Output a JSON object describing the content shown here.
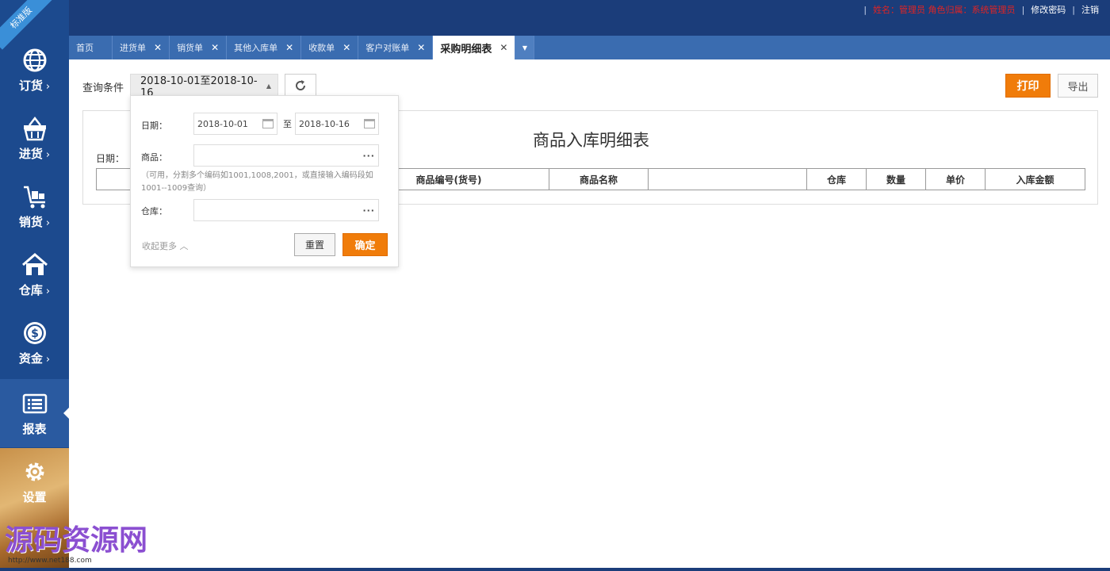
{
  "badge": "标准版",
  "topbar": {
    "user_info": "姓名：管理员  角色归属：系统管理员",
    "change_password": "修改密码",
    "logout": "注销"
  },
  "sidebar": {
    "items": [
      {
        "label": "订货",
        "icon": "globe-icon"
      },
      {
        "label": "进货",
        "icon": "basket-icon"
      },
      {
        "label": "销货",
        "icon": "cart-icon"
      },
      {
        "label": "仓库",
        "icon": "house-icon"
      },
      {
        "label": "资金",
        "icon": "dollar-icon"
      },
      {
        "label": "报表",
        "icon": "list-icon"
      },
      {
        "label": "设置",
        "icon": "gear-icon"
      }
    ],
    "chevron": "›"
  },
  "tabs": [
    {
      "label": "首页",
      "closable": false
    },
    {
      "label": "进货单",
      "closable": true
    },
    {
      "label": "销货单",
      "closable": true
    },
    {
      "label": "其他入库单",
      "closable": true
    },
    {
      "label": "收款单",
      "closable": true
    },
    {
      "label": "客户对账单",
      "closable": true
    },
    {
      "label": "采购明细表",
      "closable": true,
      "active": true
    }
  ],
  "toolbar": {
    "query_label": "查询条件",
    "date_range": "2018-10-01至2018-10-16",
    "print": "打印",
    "export": "导出"
  },
  "report": {
    "title": "商品入库明细表",
    "date_label": "日期：",
    "columns": [
      "",
      "商品编号(货号)",
      "商品名称",
      "",
      "仓库",
      "数量",
      "单价",
      "入库金额"
    ]
  },
  "popup": {
    "date_label": "日期：",
    "date_from": "2018-10-01",
    "date_to_sep": "至",
    "date_to": "2018-10-16",
    "product_label": "商品：",
    "product_hint": "（可用，分割多个编码如1001,1008,2001，或直接输入编码段如1001--1009查询）",
    "warehouse_label": "仓库：",
    "collapse": "收起更多",
    "reset": "重置",
    "confirm": "确定"
  },
  "watermark": {
    "text": "源码资源网",
    "url": "http://www.net188.com"
  },
  "colors": {
    "topbar": "#1b3d7a",
    "sidebar": "#1c4a8e",
    "tabbar": "#3a6cb0",
    "accent": "#f07c0a",
    "user_text": "#e02424"
  }
}
